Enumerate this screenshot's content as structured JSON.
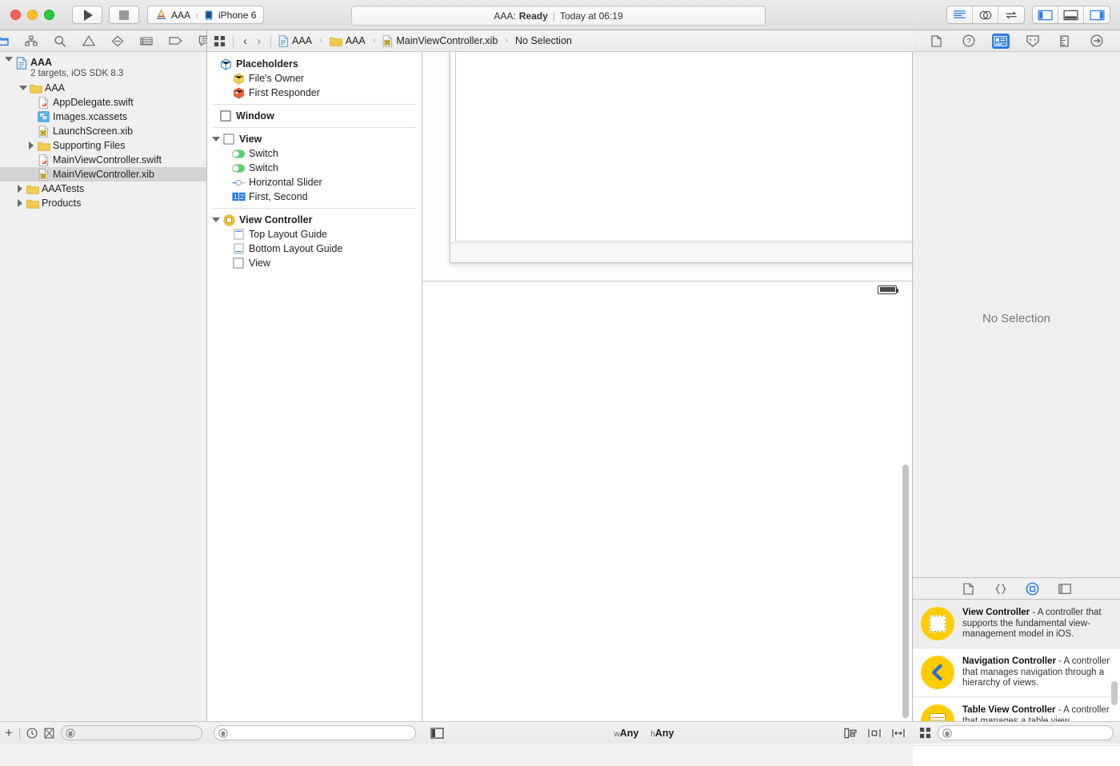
{
  "toolbar": {
    "run_label": "run-button",
    "stop_label": "stop-button",
    "scheme_app": "AAA",
    "scheme_sep": "›",
    "scheme_device": "iPhone 6",
    "status_project": "AAA:",
    "status_state": "Ready",
    "status_divider": "|",
    "status_time": "Today at 06:19"
  },
  "navigator": {
    "tabs": [
      "folder-icon",
      "sourcecontrol-icon",
      "search-icon",
      "warning-icon",
      "breakpoint-icon",
      "test-icon",
      "tag-icon",
      "report-icon"
    ],
    "project": {
      "title": "AAA",
      "subtitle": "2 targets, iOS SDK 8.3"
    },
    "items": [
      {
        "label": "AAA",
        "icon": "folder-icon",
        "indent": 22,
        "twisty": "down"
      },
      {
        "label": "AppDelegate.swift",
        "icon": "swift-icon",
        "indent": 46,
        "twisty": "none"
      },
      {
        "label": "Images.xcassets",
        "icon": "xcassets-icon",
        "indent": 46,
        "twisty": "none"
      },
      {
        "label": "LaunchScreen.xib",
        "icon": "xib-icon",
        "indent": 46,
        "twisty": "none"
      },
      {
        "label": "Supporting Files",
        "icon": "folder-icon",
        "indent": 32,
        "twisty": "right"
      },
      {
        "label": "MainViewController.swift",
        "icon": "swift-icon",
        "indent": 46,
        "twisty": "none"
      },
      {
        "label": "MainViewController.xib",
        "icon": "xib-icon",
        "indent": 46,
        "twisty": "none",
        "selected": true
      },
      {
        "label": "AAATests",
        "icon": "folder-icon",
        "indent": 18,
        "twisty": "right"
      },
      {
        "label": "Products",
        "icon": "folder-icon",
        "indent": 18,
        "twisty": "right"
      }
    ],
    "footer": {
      "add_label": "+",
      "filter_placeholder": ""
    }
  },
  "jumpbar": {
    "grid_icon": "related-items-icon",
    "back_icon": "back-chevron-icon",
    "forward_icon": "forward-chevron-icon",
    "crumbs": [
      {
        "label": "AAA",
        "icon": "project-icon"
      },
      {
        "label": "AAA",
        "icon": "folder-icon"
      },
      {
        "label": "MainViewController.xib",
        "icon": "xib-icon"
      },
      {
        "label": "No Selection",
        "icon": "none"
      }
    ],
    "separator": "›"
  },
  "outline": {
    "groups": [
      {
        "header": {
          "label": "Placeholders",
          "icon": "placeholder-icon",
          "bold": true,
          "twisty": "none",
          "indent": 16
        },
        "children": [
          {
            "label": "File's Owner",
            "icon": "files-owner-icon",
            "indent": 32
          },
          {
            "label": "First Responder",
            "icon": "first-responder-icon",
            "indent": 32
          }
        ]
      },
      {
        "header": {
          "label": "Window",
          "icon": "window-icon",
          "bold": true,
          "twisty": "none",
          "indent": 16
        },
        "children": []
      },
      {
        "header": {
          "label": "View",
          "icon": "view-icon",
          "bold": true,
          "twisty": "down",
          "indent": 4
        },
        "children": [
          {
            "label": "Switch",
            "icon": "switch-icon",
            "indent": 32
          },
          {
            "label": "Switch",
            "icon": "switch-icon",
            "indent": 32
          },
          {
            "label": "Horizontal Slider",
            "icon": "slider-icon",
            "indent": 32
          },
          {
            "label": "First, Second",
            "icon": "segmented-control-icon",
            "indent": 32
          }
        ]
      },
      {
        "header": {
          "label": "View Controller",
          "icon": "view-controller-icon",
          "bold": true,
          "twisty": "down",
          "indent": 4
        },
        "children": [
          {
            "label": "Top Layout Guide",
            "icon": "top-layout-guide-icon",
            "indent": 32
          },
          {
            "label": "Bottom Layout Guide",
            "icon": "bottom-layout-guide-icon",
            "indent": 32
          },
          {
            "label": "View",
            "icon": "view-icon",
            "indent": 32
          }
        ]
      }
    ],
    "footer": {
      "filter_placeholder": ""
    }
  },
  "inspector": {
    "tabs": [
      "file-inspector-icon",
      "quick-help-icon",
      "identity-inspector-icon",
      "attributes-inspector-icon",
      "size-inspector-icon",
      "connections-inspector-icon"
    ],
    "active_tab_index": 2,
    "empty_message": "No Selection"
  },
  "library": {
    "tabs": [
      "file-template-library-icon",
      "code-snippet-library-icon",
      "object-library-icon",
      "media-library-icon"
    ],
    "active_tab_index": 2,
    "items": [
      {
        "title": "View Controller",
        "description": " - A controller that supports the fundamental view-management model in iOS.",
        "icon": "view-controller-object-icon",
        "selected": true
      },
      {
        "title": "Navigation Controller",
        "description": " - A controller that manages navigation through a hierarchy of views.",
        "icon": "navigation-controller-object-icon",
        "selected": false
      },
      {
        "title": "Table View Controller",
        "description": " - A controller that manages a table view.",
        "icon": "table-view-controller-object-icon",
        "selected": false
      }
    ],
    "footer": {
      "filter_placeholder": ""
    }
  },
  "editor_footer": {
    "toggle_outline_icon": "toggle-document-outline-icon",
    "size_class_w_prefix": "w",
    "size_class_w_value": "Any",
    "size_class_h_prefix": "h",
    "size_class_h_value": "Any",
    "tools": [
      "align-icon",
      "pin-icon",
      "resolve-auto-layout-icon"
    ]
  }
}
